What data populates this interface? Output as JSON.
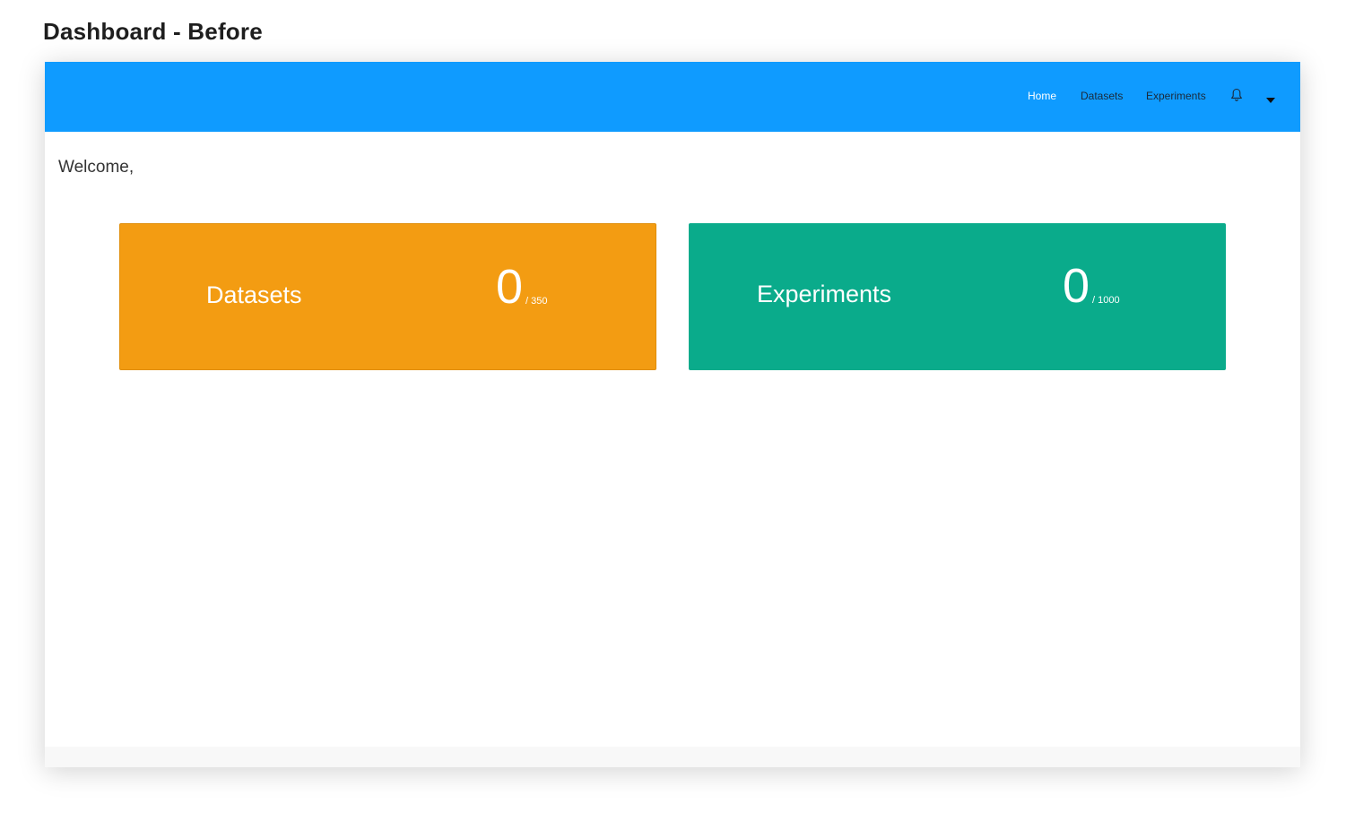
{
  "caption": "Dashboard - Before",
  "navbar": {
    "items": [
      {
        "label": "Home",
        "active": true
      },
      {
        "label": "Datasets",
        "active": false
      },
      {
        "label": "Experiments",
        "active": false
      }
    ],
    "icons": [
      "bell-icon",
      "caret-down-icon"
    ],
    "background": "#0f9bff"
  },
  "welcome": "Welcome,",
  "cards": [
    {
      "label": "Datasets",
      "count": "0",
      "limit": "/ 350",
      "color": "#f39c12"
    },
    {
      "label": "Experiments",
      "count": "0",
      "limit": "/ 1000",
      "color": "#0aab8b"
    }
  ]
}
